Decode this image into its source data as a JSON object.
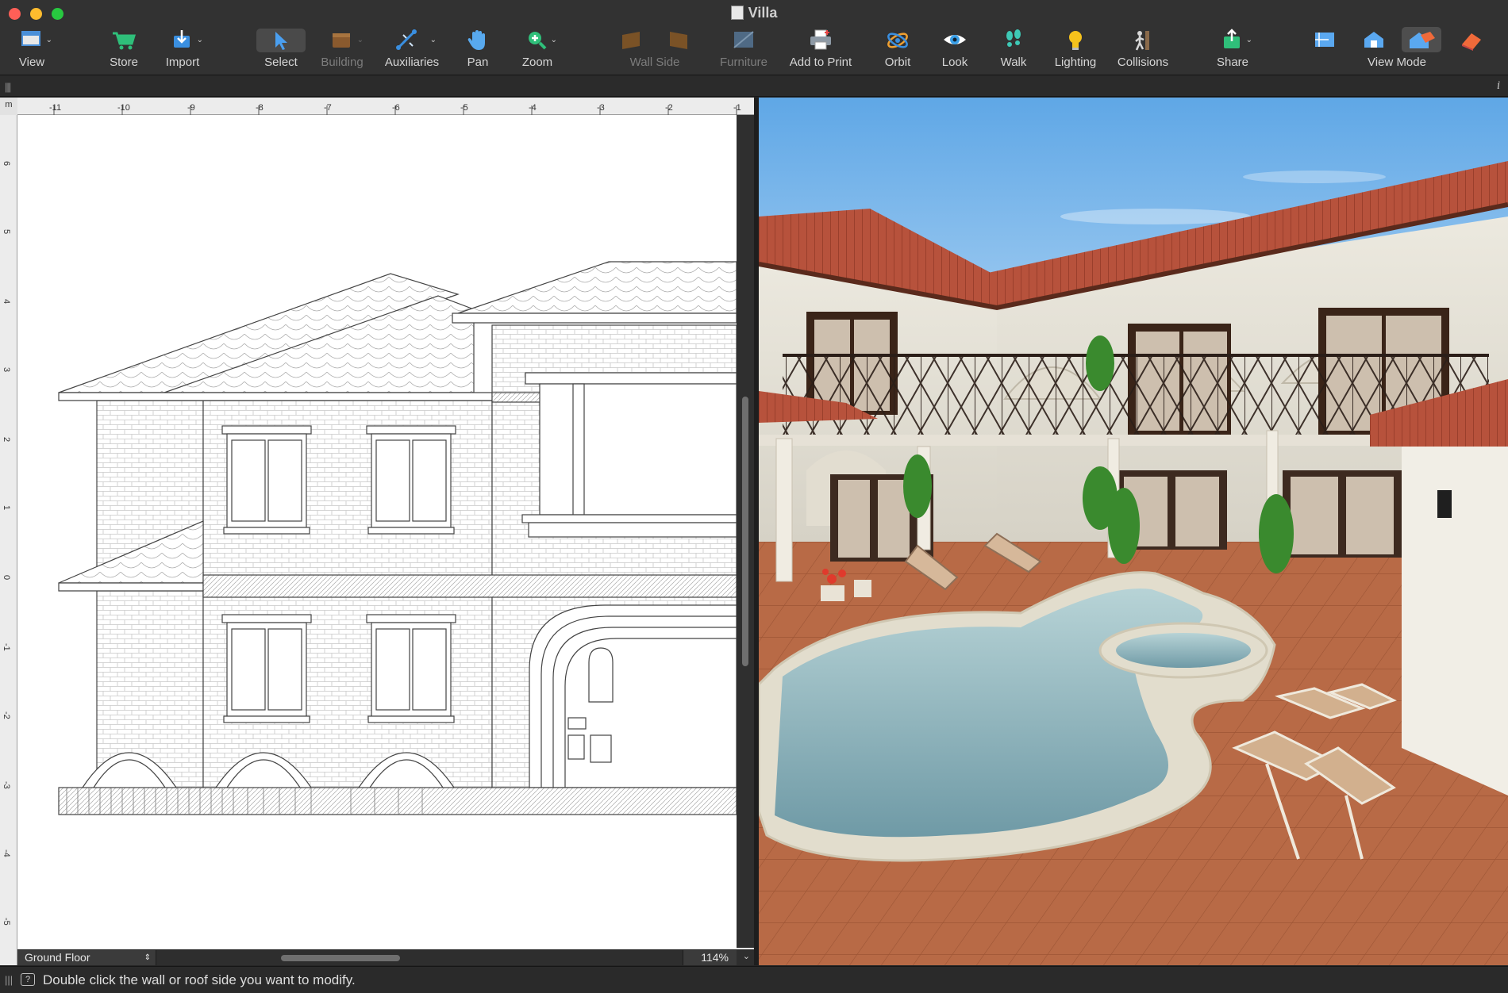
{
  "window": {
    "title": "Villa"
  },
  "toolbar": {
    "items": [
      {
        "label": "View",
        "icon": "view-icon",
        "enabled": true
      },
      {
        "label": "Store",
        "icon": "cart-icon",
        "enabled": true
      },
      {
        "label": "Import",
        "icon": "import-icon",
        "enabled": true
      },
      {
        "label": "Select",
        "icon": "arrow-pointer-icon",
        "enabled": true,
        "pressed": true
      },
      {
        "label": "Building",
        "icon": "building-icon",
        "enabled": false
      },
      {
        "label": "Auxiliaries",
        "icon": "auxiliaries-icon",
        "enabled": true
      },
      {
        "label": "Pan",
        "icon": "hand-icon",
        "enabled": true
      },
      {
        "label": "Zoom",
        "icon": "zoom-in-icon",
        "enabled": true
      },
      {
        "label": "Wall Side",
        "icon": "wall-side-icon",
        "enabled": false
      },
      {
        "label": "Furniture",
        "icon": "furniture-icon",
        "enabled": false
      },
      {
        "label": "Add to Print",
        "icon": "printer-icon",
        "enabled": true
      },
      {
        "label": "Orbit",
        "icon": "orbit-icon",
        "enabled": true
      },
      {
        "label": "Look",
        "icon": "eye-icon",
        "enabled": true
      },
      {
        "label": "Walk",
        "icon": "footprints-icon",
        "enabled": true
      },
      {
        "label": "Lighting",
        "icon": "lightbulb-icon",
        "enabled": true
      },
      {
        "label": "Collisions",
        "icon": "collisions-icon",
        "enabled": true
      },
      {
        "label": "Share",
        "icon": "share-icon",
        "enabled": true
      },
      {
        "label": "View Mode",
        "icon": "view-mode-icon",
        "enabled": true
      }
    ]
  },
  "plan": {
    "ruler_unit": "m",
    "top_ticks": [
      "-11",
      "-10",
      "-9",
      "-8",
      "-7",
      "-6",
      "-5",
      "-4",
      "-3",
      "-2",
      "-1"
    ],
    "left_ticks": [
      "6",
      "5",
      "4",
      "3",
      "2",
      "1",
      "0",
      "-1",
      "-2",
      "-3",
      "-4",
      "-5"
    ],
    "level": "Ground Floor",
    "zoom": "114%"
  },
  "status": {
    "message": "Double click the wall or roof side you want to modify."
  },
  "colors": {
    "toolbar_bg": "#323232",
    "sky": "#6fb1ea",
    "roof_tile": "#b7523c",
    "pool_water": "#8fb7bd",
    "floor_tile": "#b86a46"
  }
}
